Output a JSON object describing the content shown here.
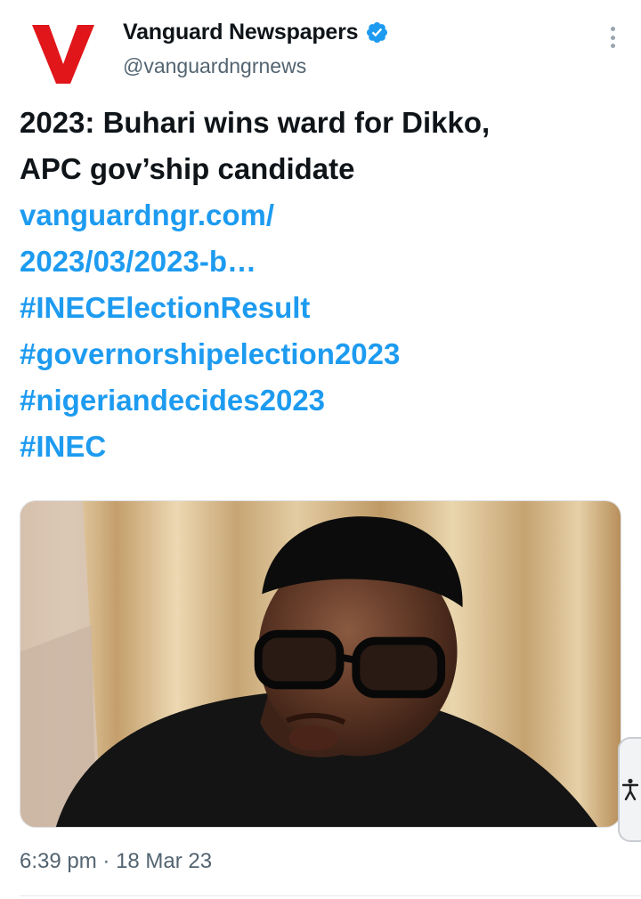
{
  "author": {
    "name": "Vanguard Newspapers",
    "handle": "@vanguardngrnews",
    "verified": true,
    "logo_letter": "V",
    "logo_color": "#e0161b"
  },
  "tweet": {
    "headline_line1": "2023: Buhari wins ward for Dikko,",
    "headline_line2": "APC gov’ship candidate",
    "link_line1": "vanguardngr.com/",
    "link_line2": "2023/03/2023-b…",
    "hashtags": [
      "#INECElectionResult",
      "#governorshipelection2023",
      "#nigeriandecides2023",
      "#INEC"
    ],
    "media_icon": "photo-of-man-in-black-cap-and-glasses"
  },
  "footer": {
    "time": "6:39 pm",
    "separator": "·",
    "date": "18 Mar 23"
  },
  "colors": {
    "link": "#1d9bf0",
    "text": "#0f1419",
    "secondary": "#536471",
    "verified_badge": "#1d9bf0"
  },
  "icons": {
    "more": "more-vertical-icon",
    "verified": "verified-badge-icon",
    "accessibility": "accessibility-icon"
  }
}
